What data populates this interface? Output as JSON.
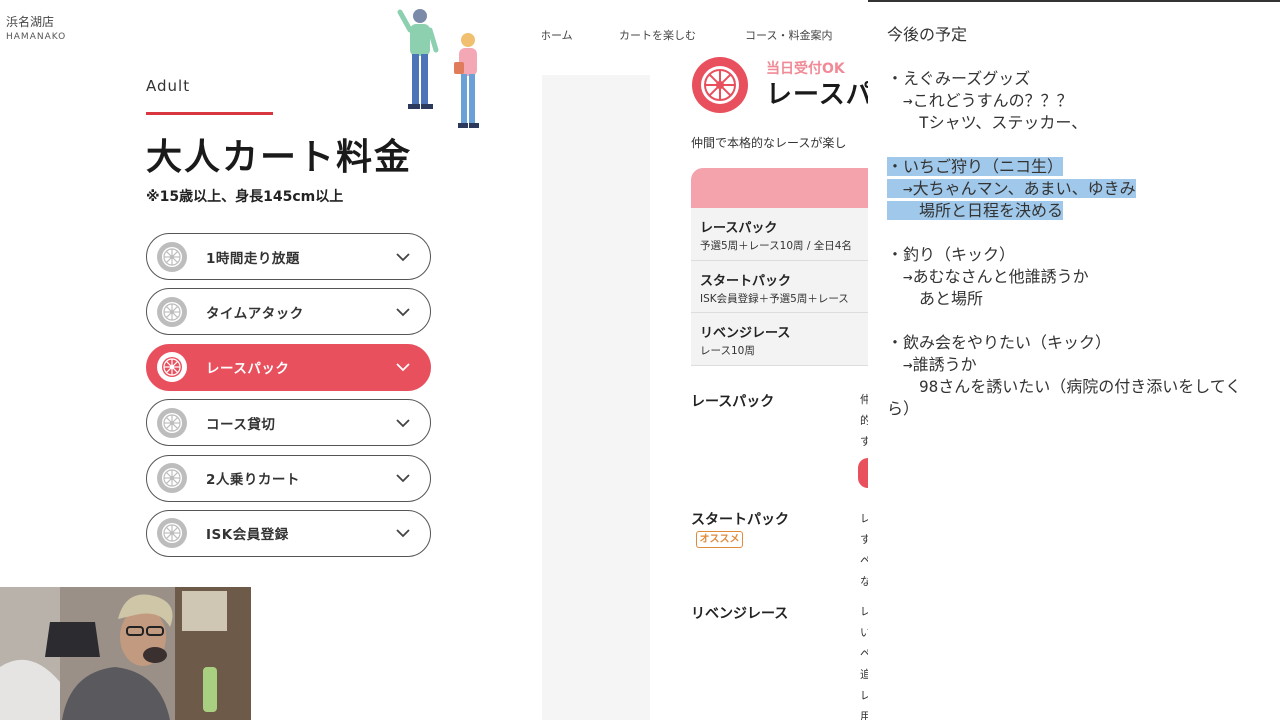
{
  "left_page": {
    "store_name_ja": "浜名湖店",
    "store_name_en": "HAMANAKO",
    "kicker": "Adult",
    "title": "大人カート料金",
    "note": "※15歳以上、身長145cm以上",
    "accordion": [
      {
        "label": "1時間走り放題",
        "active": false
      },
      {
        "label": "タイムアタック",
        "active": false
      },
      {
        "label": "レースパック",
        "active": true
      },
      {
        "label": "コース貸切",
        "active": false
      },
      {
        "label": "2人乗りカート",
        "active": false
      },
      {
        "label": "ISK会員登録",
        "active": false
      }
    ]
  },
  "middle_page": {
    "nav": [
      "ホーム",
      "カートを楽しむ",
      "コース・料金案内"
    ],
    "same_day": "当日受付OK",
    "title": "レースパ",
    "lead": "仲間で本格的なレースが楽し",
    "packs": [
      {
        "name": "レースパック",
        "sub": "予選5周＋レース10周 / 全日4名"
      },
      {
        "name": "スタートパック",
        "sub": "ISK会員登録＋予選5周＋レース"
      },
      {
        "name": "リベンジレース",
        "sub": "レース10周"
      }
    ],
    "details": [
      {
        "name": "レースパック",
        "clip": [
          "仲",
          "的",
          "す"
        ]
      },
      {
        "name": "スタートパック",
        "badge": "オススメ",
        "clip": [
          "レ",
          "す",
          "ペ",
          "な"
        ]
      },
      {
        "name": "リベンジレース",
        "clip": [
          "レ",
          "い",
          "ペ",
          "追",
          "レ",
          "用"
        ]
      }
    ]
  },
  "notepad": {
    "lines": [
      {
        "text": "今後の予定"
      },
      {
        "text": ""
      },
      {
        "text": "・えぐみーズグッズ"
      },
      {
        "text": "　→これどうすんの？？？"
      },
      {
        "text": "　　Tシャツ、ステッカー、"
      },
      {
        "text": ""
      },
      {
        "text": "・いちご狩り（ニコ生）",
        "highlight": true
      },
      {
        "text": "　→大ちゃんマン、あまい、ゆきみ",
        "highlight": true
      },
      {
        "text": "　　場所と日程を決める",
        "highlight": true
      },
      {
        "text": ""
      },
      {
        "text": "・釣り（キック）"
      },
      {
        "text": "　→あむなさんと他誰誘うか"
      },
      {
        "text": "　　あと場所"
      },
      {
        "text": ""
      },
      {
        "text": "・飲み会をやりたい（キック）"
      },
      {
        "text": "　→誰誘うか"
      },
      {
        "text": "　　98さんを誘いたい（病院の付き添いをしてく"
      },
      {
        "text": "ら）"
      }
    ]
  },
  "colors": {
    "accent_red": "#e9505e",
    "kicker_rule": "#d9373f",
    "pink_band": "#f4a3ac",
    "highlight_blue": "#9fc8ea",
    "badge_orange": "#e08a3c"
  }
}
